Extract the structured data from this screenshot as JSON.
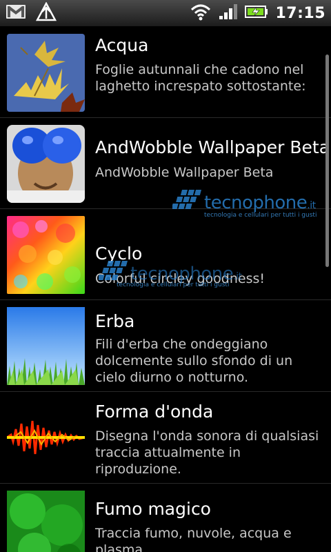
{
  "status_bar": {
    "time": "17:15",
    "icons": [
      "gmail-icon",
      "alert-icon",
      "wifi-icon",
      "signal-icon",
      "battery-charging-icon"
    ]
  },
  "wallpapers": [
    {
      "title": "Acqua",
      "description": "Foglie autunnali che cadono nel laghetto increspato sottostante:"
    },
    {
      "title": "AndWobble Wallpaper Beta",
      "description": "AndWobble Wallpaper Beta"
    },
    {
      "title": "Cyclo",
      "description": "Colorful circley goodness!"
    },
    {
      "title": "Erba",
      "description": "Fili d'erba che ondeggiano dolcemente sullo sfondo di un cielo diurno o notturno."
    },
    {
      "title": "Forma d'onda",
      "description": "Disegna l'onda sonora di qualsiasi traccia attualmente in riproduzione."
    },
    {
      "title": "Fumo magico",
      "description": "Traccia fumo, nuvole, acqua e plasma"
    }
  ],
  "watermark": {
    "name": "tecnophone",
    "suffix": ".it",
    "tagline": "tecnologia e cellulari per tutti i gusti"
  },
  "colors": {
    "background": "#000000",
    "watermark": "#2a7fc9"
  }
}
